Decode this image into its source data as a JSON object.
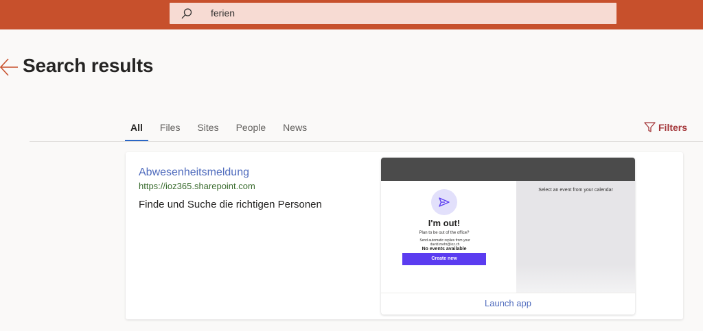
{
  "search": {
    "value": "ferien"
  },
  "page": {
    "title": "Search results"
  },
  "tabs": [
    {
      "label": "All",
      "active": true
    },
    {
      "label": "Files"
    },
    {
      "label": "Sites"
    },
    {
      "label": "People"
    },
    {
      "label": "News"
    }
  ],
  "filters": {
    "label": "Filters"
  },
  "result": {
    "title": "Abwesenheitsmeldung",
    "url": "https://ioz365.sharepoint.com",
    "description": "Finde und Suche die richtigen Personen",
    "preview": {
      "right_text": "Select an event from your calendar",
      "heading": "I'm out!",
      "plan_text": "Plan to be out of the office?",
      "auto_text": "Send automatic replies from your david.mehr@ioz.ch",
      "no_events": "No events available",
      "create_label": "Create new",
      "launch_label": "Launch app"
    }
  },
  "colors": {
    "topbar": "#c7502c",
    "accent": "#2b67c6",
    "link": "#4f6bbd",
    "url": "#3a6c2f",
    "filters": "#a4373a",
    "create_button": "#5b3cf0"
  },
  "icons": {
    "search": "search-icon",
    "back": "back-arrow-icon",
    "filter": "filter-icon",
    "send": "send-icon"
  }
}
